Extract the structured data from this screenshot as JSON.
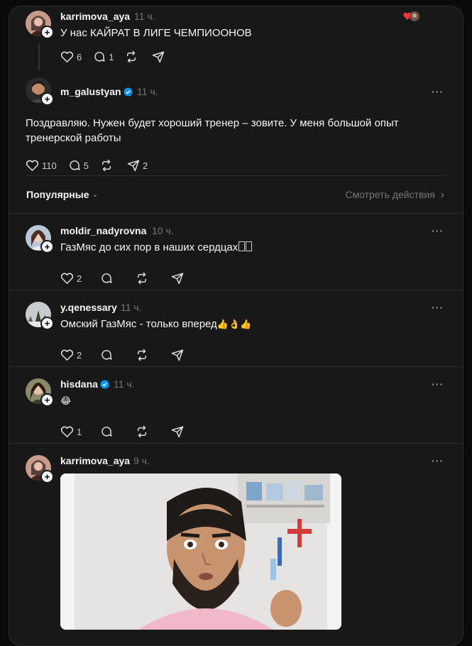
{
  "thread": {
    "original": {
      "username": "karrimova_aya",
      "time": "11 ч.",
      "text": "У нас КАЙРАТ В ЛИГЕ ЧЕМПИООНОВ",
      "likes": "6",
      "replies": "1"
    },
    "reply": {
      "username": "m_galustyan",
      "time": "11 ч.",
      "text": "Поздравляю. Нужен будет хороший тренер – зовите. У меня большой опыт тренерской работы",
      "likes": "110",
      "replies": "5",
      "shares": "2"
    }
  },
  "sort": {
    "label": "Популярные",
    "chevron": "⌄",
    "activity_link": "Смотреть действия",
    "activity_chevron": "›"
  },
  "comments": [
    {
      "username": "moldir_nadyrovna",
      "time": "10 ч.",
      "text": "ГазМяс до сих пор в наших сердцах",
      "likes": "2"
    },
    {
      "username": "y.qenessary",
      "time": "11 ч.",
      "text": "Омский ГазМяс - только вперед",
      "emoji": "👍👌👍",
      "likes": "2"
    },
    {
      "username": "hisdana",
      "time": "11 ч.",
      "text": "",
      "emoji": "😂",
      "likes": "1"
    },
    {
      "username": "karrimova_aya",
      "time": "9 ч.",
      "text": ""
    }
  ],
  "ui": {
    "more": "···",
    "plus": "+"
  },
  "colors": {
    "background": "#0a0a0a",
    "card": "#181818",
    "border": "#2d2d2d",
    "text": "#f3f5f7",
    "muted": "#777777",
    "verified": "#0095f6",
    "like_red": "#ff3040"
  },
  "icons": [
    "heart-icon",
    "comment-icon",
    "repost-icon",
    "share-icon",
    "more-icon",
    "verified-icon",
    "chevron-down-icon",
    "chevron-right-icon",
    "plus-icon"
  ]
}
